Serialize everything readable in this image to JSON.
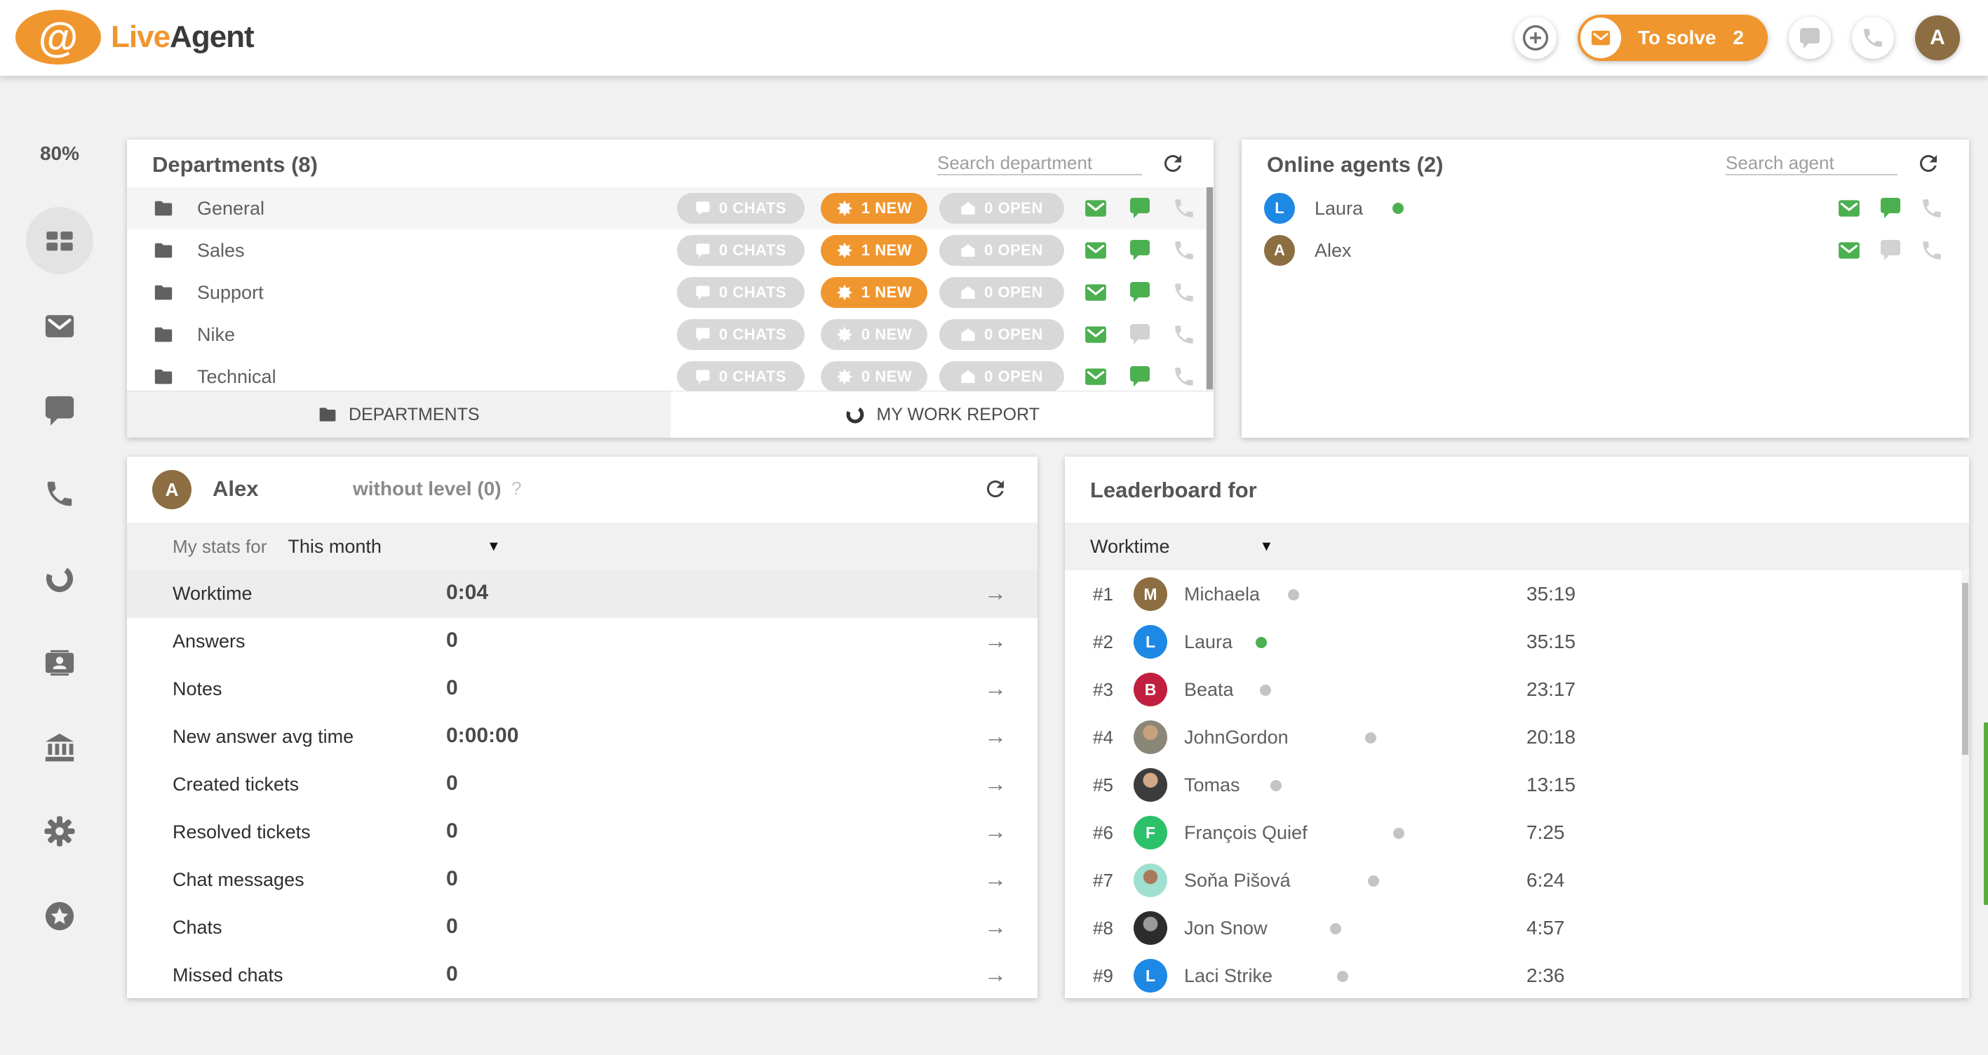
{
  "topbar": {
    "logo_symbol": "@",
    "logo_live": "Live",
    "logo_agent": "Agent",
    "to_solve_label": "To solve",
    "to_solve_count": "2",
    "avatar_initial": "A",
    "avatar_color": "#8d6e42"
  },
  "sidebar": {
    "usage_percent": "80%",
    "icons": [
      "dashboard-grid",
      "mail",
      "chat",
      "phone",
      "sync",
      "contacts-card",
      "bank",
      "gear",
      "star-circle"
    ]
  },
  "departments": {
    "title": "Departments (8)",
    "search_placeholder": "Search department",
    "rows": [
      {
        "name": "General",
        "chats": "0 CHATS",
        "new": "1 NEW",
        "open": "0 OPEN"
      },
      {
        "name": "Sales",
        "chats": "0 CHATS",
        "new": "1 NEW",
        "open": "0 OPEN"
      },
      {
        "name": "Support",
        "chats": "0 CHATS",
        "new": "1 NEW",
        "open": "0 OPEN"
      },
      {
        "name": "Nike",
        "chats": "0 CHATS",
        "new": "0 NEW",
        "open": "0 OPEN"
      },
      {
        "name": "Technical",
        "chats": "0 CHATS",
        "new": "0 NEW",
        "open": "0 OPEN"
      }
    ],
    "tabs": {
      "departments": "DEPARTMENTS",
      "my_work_report": "MY WORK REPORT"
    }
  },
  "online_agents": {
    "title": "Online agents (2)",
    "search_placeholder": "Search agent",
    "rows": [
      {
        "initial": "L",
        "name": "Laura",
        "avatar_color": "#1e88e5",
        "status_color": "#4caf50"
      },
      {
        "initial": "A",
        "name": "Alex",
        "avatar_color": "#8d6e42"
      }
    ]
  },
  "my_stats": {
    "agent_initial": "A",
    "agent_avatar_color": "#8d6e42",
    "agent_name": "Alex",
    "level": "without level (0)",
    "help": "?",
    "stats_for_label": "My stats for",
    "period": "This month",
    "rows": [
      {
        "label": "Worktime",
        "value": "0:04"
      },
      {
        "label": "Answers",
        "value": "0"
      },
      {
        "label": "Notes",
        "value": "0"
      },
      {
        "label": "New answer avg time",
        "value": "0:00:00"
      },
      {
        "label": "Created tickets",
        "value": "0"
      },
      {
        "label": "Resolved tickets",
        "value": "0"
      },
      {
        "label": "Chat messages",
        "value": "0"
      },
      {
        "label": "Chats",
        "value": "0"
      },
      {
        "label": "Missed chats",
        "value": "0"
      }
    ]
  },
  "leaderboard": {
    "title": "Leaderboard for",
    "metric": "Worktime",
    "rows": [
      {
        "rank": "#1",
        "name": "Michaela",
        "time": "35:19",
        "status_color": "#c4c4c4",
        "avatar": {
          "type": "initial",
          "initial": "M",
          "color": "#8d6e42"
        }
      },
      {
        "rank": "#2",
        "name": "Laura",
        "time": "35:15",
        "status_color": "#4caf50",
        "avatar": {
          "type": "initial",
          "initial": "L",
          "color": "#1e88e5"
        }
      },
      {
        "rank": "#3",
        "name": "Beata",
        "time": "23:17",
        "status_color": "#c4c4c4",
        "avatar": {
          "type": "initial",
          "initial": "B",
          "color": "#c11f3f"
        }
      },
      {
        "rank": "#4",
        "name": "JohnGordon",
        "time": "20:18",
        "status_color": "#c4c4c4",
        "avatar": {
          "type": "photo",
          "desc": "man in suit"
        }
      },
      {
        "rank": "#5",
        "name": "Tomas",
        "time": "13:15",
        "status_color": "#c4c4c4",
        "avatar": {
          "type": "photo",
          "desc": "smiling man, dark shirt"
        }
      },
      {
        "rank": "#6",
        "name": "François Quief",
        "time": "7:25",
        "status_color": "#c4c4c4",
        "avatar": {
          "type": "initial",
          "initial": "F",
          "color": "#2bc06a"
        }
      },
      {
        "rank": "#7",
        "name": "Soňa Pišová",
        "time": "6:24",
        "status_color": "#c4c4c4",
        "avatar": {
          "type": "photo",
          "desc": "woman, mint background"
        }
      },
      {
        "rank": "#8",
        "name": "Jon Snow",
        "time": "4:57",
        "status_color": "#c4c4c4",
        "avatar": {
          "type": "photo",
          "desc": "dark portrait"
        }
      },
      {
        "rank": "#9",
        "name": "Laci Strike",
        "time": "2:36",
        "status_color": "#c4c4c4",
        "avatar": {
          "type": "initial",
          "initial": "L",
          "color": "#1e88e5"
        }
      }
    ]
  },
  "colors": {
    "accent_orange": "#f0962e",
    "action_green": "#4caf50",
    "badge_gray": "#d8d8d8",
    "page_background": "#f1f1f1"
  }
}
